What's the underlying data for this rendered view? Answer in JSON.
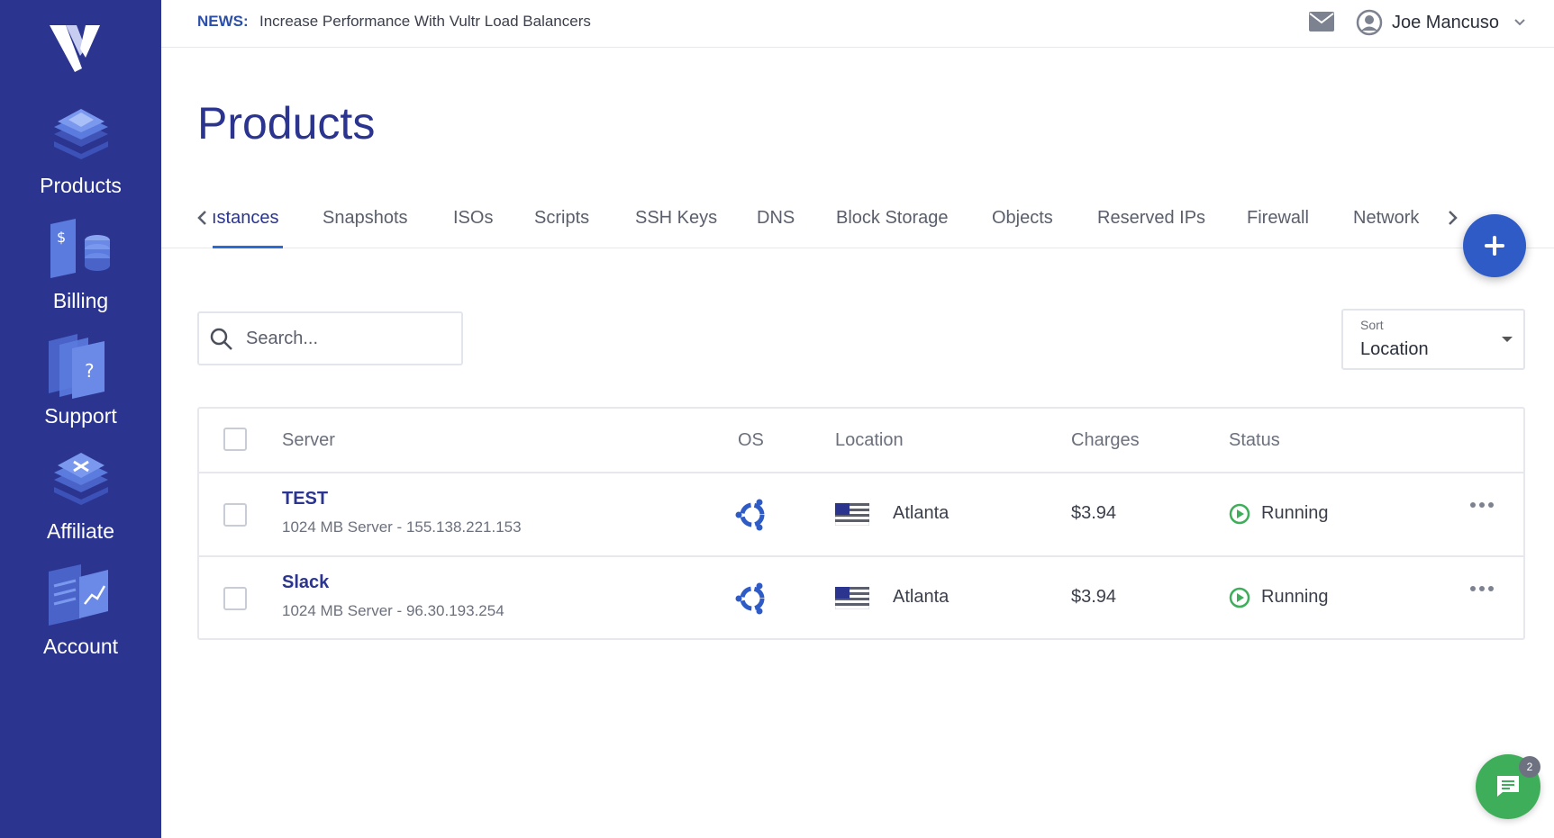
{
  "colors": {
    "sidebar_bg": "#2b3590",
    "accent": "#2f5bc7",
    "title": "#2b3590",
    "running": "#3fae5a",
    "chat": "#3fae5a"
  },
  "sidebar": {
    "logo": "vultr-logo",
    "items": [
      {
        "label": "Products",
        "icon": "products-icon"
      },
      {
        "label": "Billing",
        "icon": "billing-icon"
      },
      {
        "label": "Support",
        "icon": "support-icon"
      },
      {
        "label": "Affiliate",
        "icon": "affiliate-icon"
      },
      {
        "label": "Account",
        "icon": "account-icon"
      }
    ]
  },
  "topbar": {
    "news_label": "NEWS:",
    "news_text": "Increase Performance With Vultr Load Balancers",
    "user_name": "Joe Mancuso"
  },
  "page": {
    "title": "Products"
  },
  "tabs": [
    "ıstances",
    "Snapshots",
    "ISOs",
    "Scripts",
    "SSH Keys",
    "DNS",
    "Block Storage",
    "Objects",
    "Reserved IPs",
    "Firewall",
    "Network"
  ],
  "active_tab": "ıstances",
  "search": {
    "placeholder": "Search..."
  },
  "sort": {
    "label": "Sort",
    "value": "Location"
  },
  "table": {
    "headers": [
      "Server",
      "OS",
      "Location",
      "Charges",
      "Status"
    ],
    "rows": [
      {
        "name": "TEST",
        "desc": "1024 MB Server - 155.138.221.153",
        "os": "ubuntu-icon",
        "location": "Atlanta",
        "flag": "us-flag-icon",
        "charges": "$3.94",
        "status": "Running"
      },
      {
        "name": "Slack",
        "desc": "1024 MB Server - 96.30.193.254",
        "os": "ubuntu-icon",
        "location": "Atlanta",
        "flag": "us-flag-icon",
        "charges": "$3.94",
        "status": "Running"
      }
    ]
  },
  "chat": {
    "badge": "2"
  }
}
